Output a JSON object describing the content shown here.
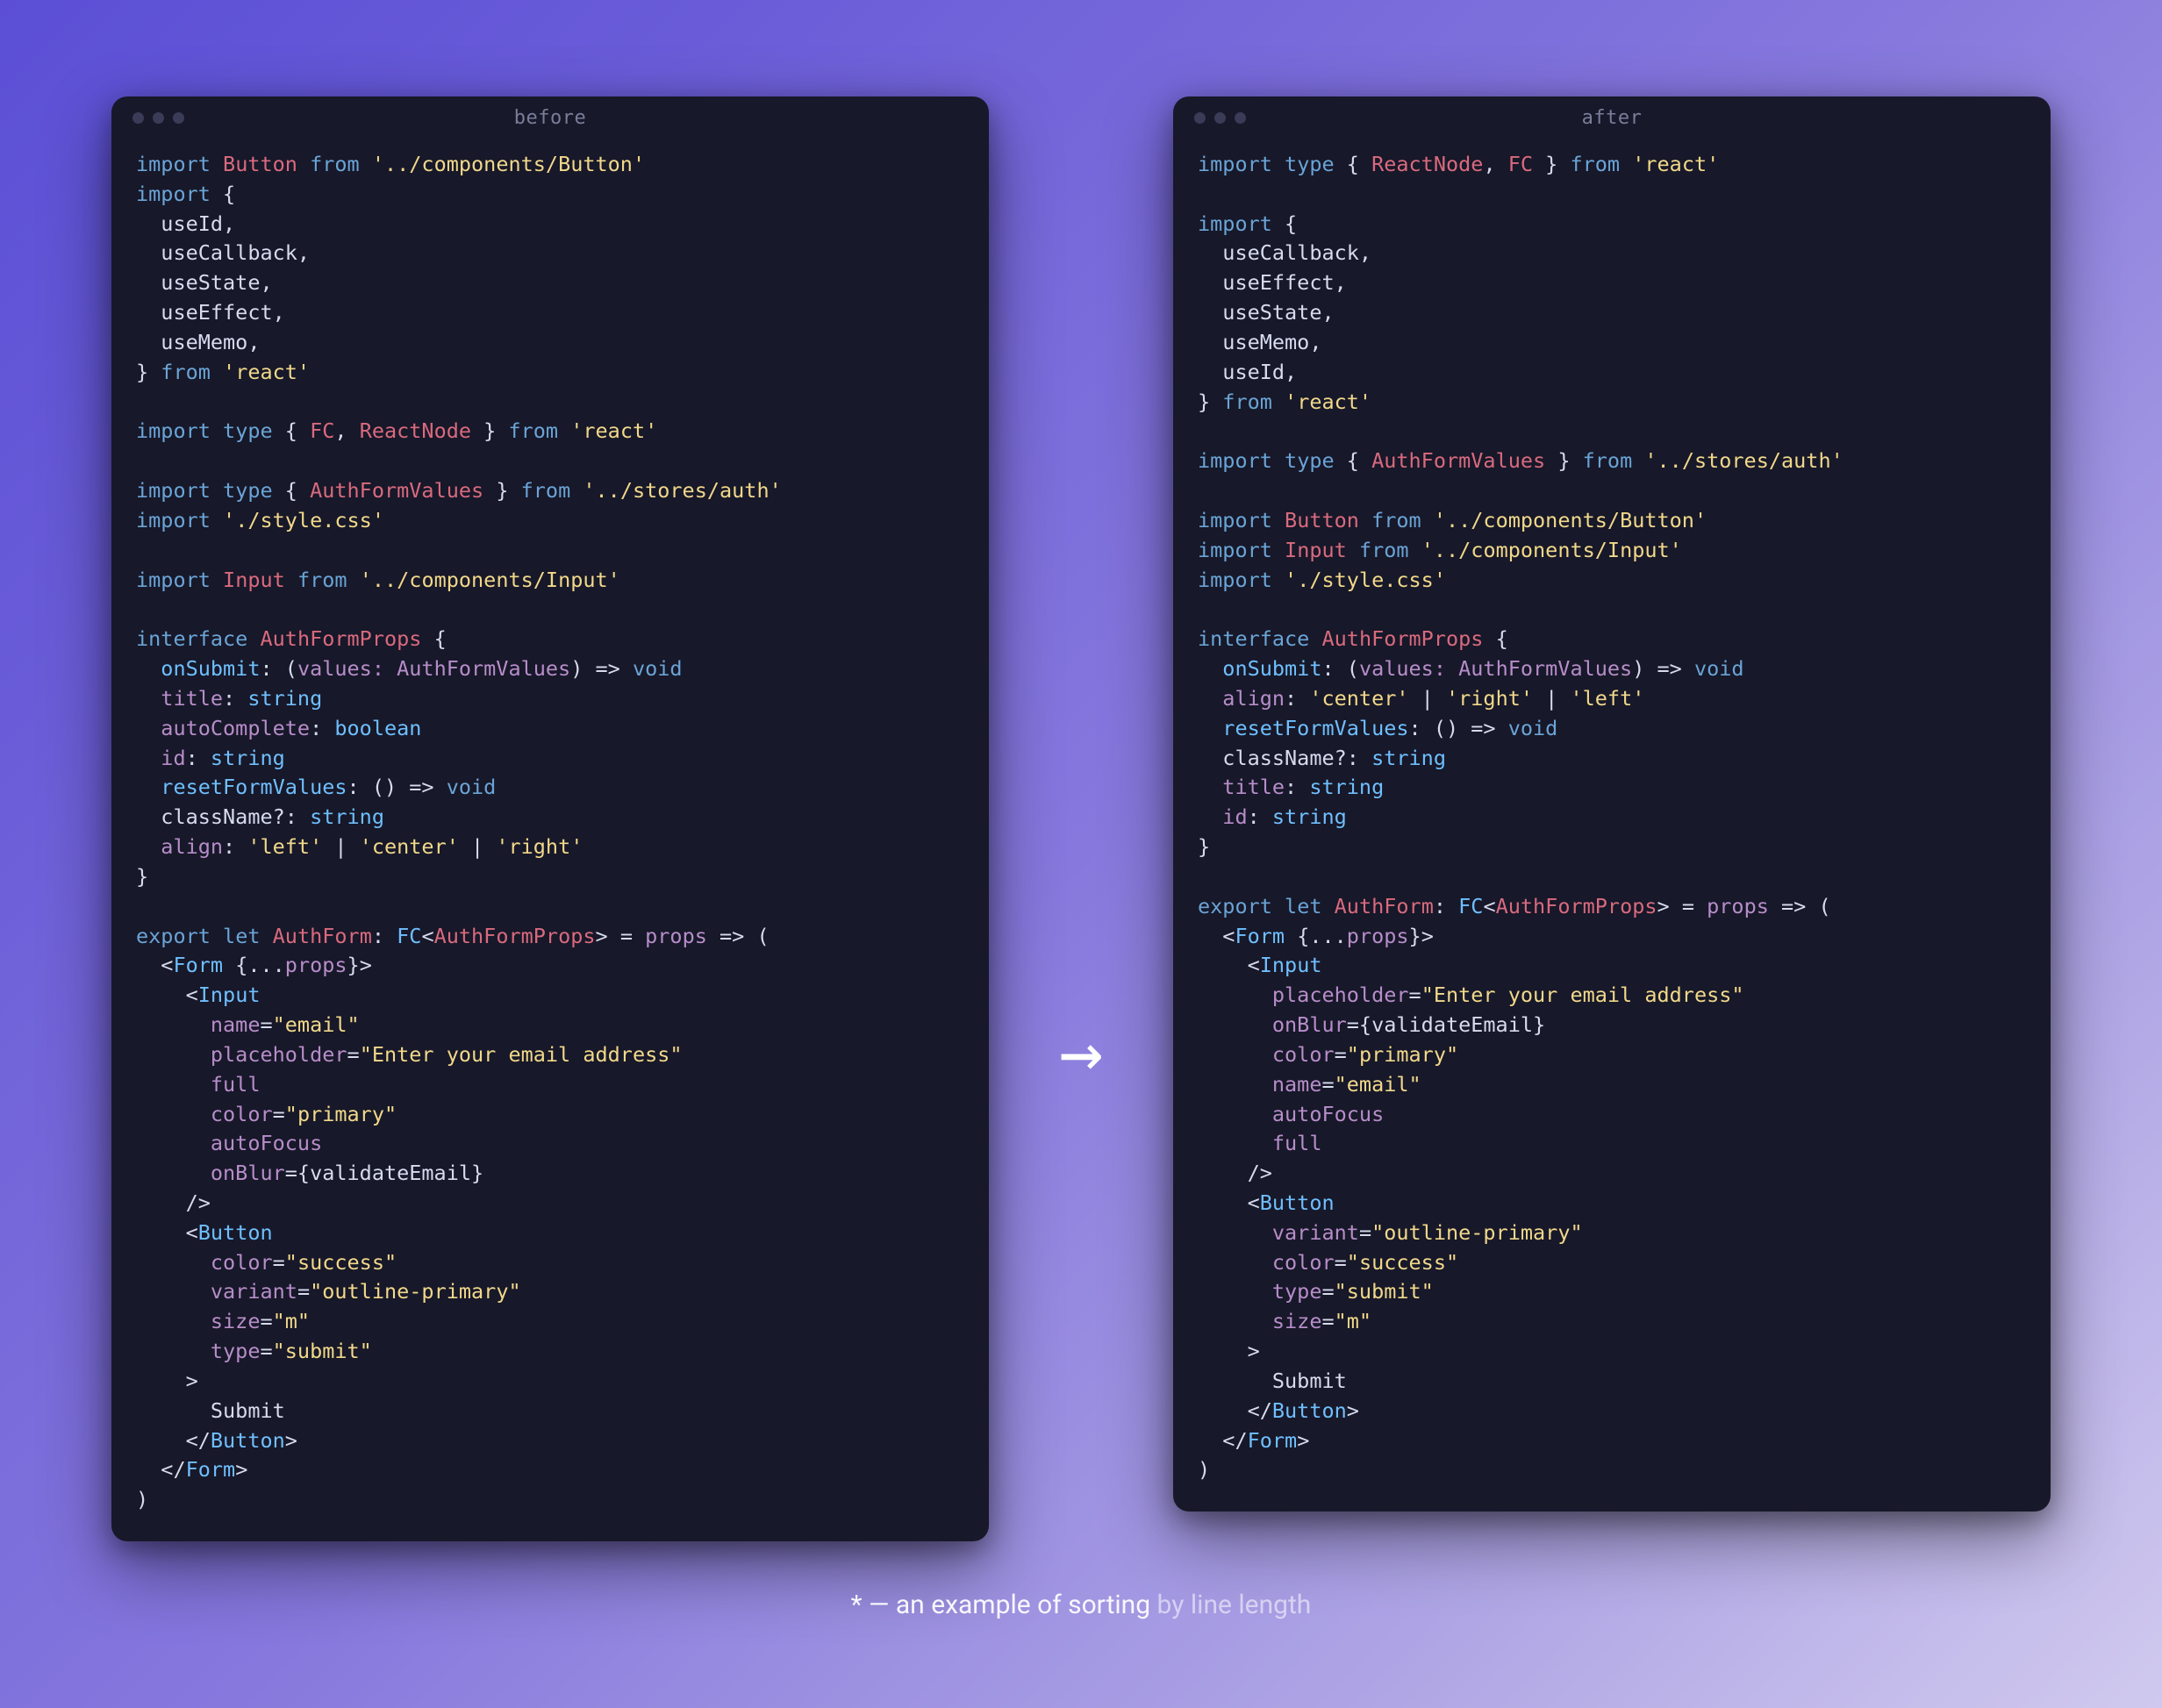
{
  "left": {
    "title": "before",
    "lines": [
      [
        [
          "kw",
          "import"
        ],
        [
          "plain",
          " "
        ],
        [
          "id-red",
          "Button"
        ],
        [
          "plain",
          " "
        ],
        [
          "kw",
          "from"
        ],
        [
          "plain",
          " "
        ],
        [
          "str",
          "'../components/Button'"
        ]
      ],
      [
        [
          "kw",
          "import"
        ],
        [
          "plain",
          " {"
        ]
      ],
      [
        [
          "plain",
          "  useId,"
        ]
      ],
      [
        [
          "plain",
          "  useCallback,"
        ]
      ],
      [
        [
          "plain",
          "  useState,"
        ]
      ],
      [
        [
          "plain",
          "  useEffect,"
        ]
      ],
      [
        [
          "plain",
          "  useMemo,"
        ]
      ],
      [
        [
          "plain",
          "} "
        ],
        [
          "kw",
          "from"
        ],
        [
          "plain",
          " "
        ],
        [
          "str",
          "'react'"
        ]
      ],
      [
        [
          "plain",
          ""
        ]
      ],
      [
        [
          "kw",
          "import"
        ],
        [
          "plain",
          " "
        ],
        [
          "kw",
          "type"
        ],
        [
          "plain",
          " { "
        ],
        [
          "id-red",
          "FC"
        ],
        [
          "plain",
          ", "
        ],
        [
          "id-red",
          "ReactNode"
        ],
        [
          "plain",
          " } "
        ],
        [
          "kw",
          "from"
        ],
        [
          "plain",
          " "
        ],
        [
          "str",
          "'react'"
        ]
      ],
      [
        [
          "plain",
          ""
        ]
      ],
      [
        [
          "kw",
          "import"
        ],
        [
          "plain",
          " "
        ],
        [
          "kw",
          "type"
        ],
        [
          "plain",
          " { "
        ],
        [
          "id-red",
          "AuthFormValues"
        ],
        [
          "plain",
          " } "
        ],
        [
          "kw",
          "from"
        ],
        [
          "plain",
          " "
        ],
        [
          "str",
          "'../stores/auth'"
        ]
      ],
      [
        [
          "kw",
          "import"
        ],
        [
          "plain",
          " "
        ],
        [
          "str",
          "'./style.css'"
        ]
      ],
      [
        [
          "plain",
          ""
        ]
      ],
      [
        [
          "kw",
          "import"
        ],
        [
          "plain",
          " "
        ],
        [
          "id-red",
          "Input"
        ],
        [
          "plain",
          " "
        ],
        [
          "kw",
          "from"
        ],
        [
          "plain",
          " "
        ],
        [
          "str",
          "'../components/Input'"
        ]
      ],
      [
        [
          "plain",
          ""
        ]
      ],
      [
        [
          "kw",
          "interface"
        ],
        [
          "plain",
          " "
        ],
        [
          "id-red",
          "AuthFormProps"
        ],
        [
          "plain",
          " {"
        ]
      ],
      [
        [
          "plain",
          "  "
        ],
        [
          "func",
          "onSubmit"
        ],
        [
          "plain",
          ": ("
        ],
        [
          "prop",
          "values: AuthFormValues"
        ],
        [
          "plain",
          ") => "
        ],
        [
          "kw",
          "void"
        ]
      ],
      [
        [
          "plain",
          "  "
        ],
        [
          "prop",
          "title"
        ],
        [
          "plain",
          ": "
        ],
        [
          "type",
          "string"
        ]
      ],
      [
        [
          "plain",
          "  "
        ],
        [
          "prop",
          "autoComplete"
        ],
        [
          "plain",
          ": "
        ],
        [
          "type",
          "boolean"
        ]
      ],
      [
        [
          "plain",
          "  "
        ],
        [
          "prop",
          "id"
        ],
        [
          "plain",
          ": "
        ],
        [
          "type",
          "string"
        ]
      ],
      [
        [
          "plain",
          "  "
        ],
        [
          "func",
          "resetFormValues"
        ],
        [
          "plain",
          ": () => "
        ],
        [
          "kw",
          "void"
        ]
      ],
      [
        [
          "plain",
          "  className?: "
        ],
        [
          "type",
          "string"
        ]
      ],
      [
        [
          "plain",
          "  "
        ],
        [
          "prop",
          "align"
        ],
        [
          "plain",
          ": "
        ],
        [
          "str",
          "'left'"
        ],
        [
          "plain",
          " | "
        ],
        [
          "str",
          "'center'"
        ],
        [
          "plain",
          " | "
        ],
        [
          "str",
          "'right'"
        ]
      ],
      [
        [
          "plain",
          "}"
        ]
      ],
      [
        [
          "plain",
          ""
        ]
      ],
      [
        [
          "kw",
          "export"
        ],
        [
          "plain",
          " "
        ],
        [
          "kw",
          "let"
        ],
        [
          "plain",
          " "
        ],
        [
          "id-red",
          "AuthForm"
        ],
        [
          "plain",
          ": "
        ],
        [
          "type",
          "FC"
        ],
        [
          "plain",
          "<"
        ],
        [
          "id-red",
          "AuthFormProps"
        ],
        [
          "plain",
          "> = "
        ],
        [
          "prop",
          "props"
        ],
        [
          "plain",
          " => ("
        ]
      ],
      [
        [
          "plain",
          "  <"
        ],
        [
          "jsx",
          "Form"
        ],
        [
          "plain",
          " {..."
        ],
        [
          "prop",
          "props"
        ],
        [
          "plain",
          "}>"
        ]
      ],
      [
        [
          "plain",
          "    <"
        ],
        [
          "jsx",
          "Input"
        ]
      ],
      [
        [
          "plain",
          "      "
        ],
        [
          "prop",
          "name"
        ],
        [
          "plain",
          "="
        ],
        [
          "str",
          "\"email\""
        ]
      ],
      [
        [
          "plain",
          "      "
        ],
        [
          "prop",
          "placeholder"
        ],
        [
          "plain",
          "="
        ],
        [
          "str",
          "\"Enter your email address\""
        ]
      ],
      [
        [
          "plain",
          "      "
        ],
        [
          "prop",
          "full"
        ]
      ],
      [
        [
          "plain",
          "      "
        ],
        [
          "prop",
          "color"
        ],
        [
          "plain",
          "="
        ],
        [
          "str",
          "\"primary\""
        ]
      ],
      [
        [
          "plain",
          "      "
        ],
        [
          "prop",
          "autoFocus"
        ]
      ],
      [
        [
          "plain",
          "      "
        ],
        [
          "prop",
          "onBlur"
        ],
        [
          "plain",
          "={"
        ],
        [
          "plain",
          "validateEmail"
        ],
        [
          "plain",
          "}"
        ]
      ],
      [
        [
          "plain",
          "    />"
        ]
      ],
      [
        [
          "plain",
          "    <"
        ],
        [
          "jsx",
          "Button"
        ]
      ],
      [
        [
          "plain",
          "      "
        ],
        [
          "prop",
          "color"
        ],
        [
          "plain",
          "="
        ],
        [
          "str",
          "\"success\""
        ]
      ],
      [
        [
          "plain",
          "      "
        ],
        [
          "prop",
          "variant"
        ],
        [
          "plain",
          "="
        ],
        [
          "str",
          "\"outline-primary\""
        ]
      ],
      [
        [
          "plain",
          "      "
        ],
        [
          "prop",
          "size"
        ],
        [
          "plain",
          "="
        ],
        [
          "str",
          "\"m\""
        ]
      ],
      [
        [
          "plain",
          "      "
        ],
        [
          "prop",
          "type"
        ],
        [
          "plain",
          "="
        ],
        [
          "str",
          "\"submit\""
        ]
      ],
      [
        [
          "plain",
          "    >"
        ]
      ],
      [
        [
          "plain",
          "      Submit"
        ]
      ],
      [
        [
          "plain",
          "    </"
        ],
        [
          "jsx",
          "Button"
        ],
        [
          "plain",
          ">"
        ]
      ],
      [
        [
          "plain",
          "  </"
        ],
        [
          "jsx",
          "Form"
        ],
        [
          "plain",
          ">"
        ]
      ],
      [
        [
          "plain",
          ")"
        ]
      ]
    ]
  },
  "right": {
    "title": "after",
    "lines": [
      [
        [
          "kw",
          "import"
        ],
        [
          "plain",
          " "
        ],
        [
          "kw",
          "type"
        ],
        [
          "plain",
          " { "
        ],
        [
          "id-red",
          "ReactNode"
        ],
        [
          "plain",
          ", "
        ],
        [
          "id-red",
          "FC"
        ],
        [
          "plain",
          " } "
        ],
        [
          "kw",
          "from"
        ],
        [
          "plain",
          " "
        ],
        [
          "str",
          "'react'"
        ]
      ],
      [
        [
          "plain",
          ""
        ]
      ],
      [
        [
          "kw",
          "import"
        ],
        [
          "plain",
          " {"
        ]
      ],
      [
        [
          "plain",
          "  useCallback,"
        ]
      ],
      [
        [
          "plain",
          "  useEffect,"
        ]
      ],
      [
        [
          "plain",
          "  useState,"
        ]
      ],
      [
        [
          "plain",
          "  useMemo,"
        ]
      ],
      [
        [
          "plain",
          "  useId,"
        ]
      ],
      [
        [
          "plain",
          "} "
        ],
        [
          "kw",
          "from"
        ],
        [
          "plain",
          " "
        ],
        [
          "str",
          "'react'"
        ]
      ],
      [
        [
          "plain",
          ""
        ]
      ],
      [
        [
          "kw",
          "import"
        ],
        [
          "plain",
          " "
        ],
        [
          "kw",
          "type"
        ],
        [
          "plain",
          " { "
        ],
        [
          "id-red",
          "AuthFormValues"
        ],
        [
          "plain",
          " } "
        ],
        [
          "kw",
          "from"
        ],
        [
          "plain",
          " "
        ],
        [
          "str",
          "'../stores/auth'"
        ]
      ],
      [
        [
          "plain",
          ""
        ]
      ],
      [
        [
          "kw",
          "import"
        ],
        [
          "plain",
          " "
        ],
        [
          "id-red",
          "Button"
        ],
        [
          "plain",
          " "
        ],
        [
          "kw",
          "from"
        ],
        [
          "plain",
          " "
        ],
        [
          "str",
          "'../components/Button'"
        ]
      ],
      [
        [
          "kw",
          "import"
        ],
        [
          "plain",
          " "
        ],
        [
          "id-red",
          "Input"
        ],
        [
          "plain",
          " "
        ],
        [
          "kw",
          "from"
        ],
        [
          "plain",
          " "
        ],
        [
          "str",
          "'../components/Input'"
        ]
      ],
      [
        [
          "kw",
          "import"
        ],
        [
          "plain",
          " "
        ],
        [
          "str",
          "'./style.css'"
        ]
      ],
      [
        [
          "plain",
          ""
        ]
      ],
      [
        [
          "kw",
          "interface"
        ],
        [
          "plain",
          " "
        ],
        [
          "id-red",
          "AuthFormProps"
        ],
        [
          "plain",
          " {"
        ]
      ],
      [
        [
          "plain",
          "  "
        ],
        [
          "func",
          "onSubmit"
        ],
        [
          "plain",
          ": ("
        ],
        [
          "prop",
          "values: AuthFormValues"
        ],
        [
          "plain",
          ") => "
        ],
        [
          "kw",
          "void"
        ]
      ],
      [
        [
          "plain",
          "  "
        ],
        [
          "prop",
          "align"
        ],
        [
          "plain",
          ": "
        ],
        [
          "str",
          "'center'"
        ],
        [
          "plain",
          " | "
        ],
        [
          "str",
          "'right'"
        ],
        [
          "plain",
          " | "
        ],
        [
          "str",
          "'left'"
        ]
      ],
      [
        [
          "plain",
          "  "
        ],
        [
          "func",
          "resetFormValues"
        ],
        [
          "plain",
          ": () => "
        ],
        [
          "kw",
          "void"
        ]
      ],
      [
        [
          "plain",
          "  className?: "
        ],
        [
          "type",
          "string"
        ]
      ],
      [
        [
          "plain",
          "  "
        ],
        [
          "prop",
          "title"
        ],
        [
          "plain",
          ": "
        ],
        [
          "type",
          "string"
        ]
      ],
      [
        [
          "plain",
          "  "
        ],
        [
          "prop",
          "id"
        ],
        [
          "plain",
          ": "
        ],
        [
          "type",
          "string"
        ]
      ],
      [
        [
          "plain",
          "}"
        ]
      ],
      [
        [
          "plain",
          ""
        ]
      ],
      [
        [
          "kw",
          "export"
        ],
        [
          "plain",
          " "
        ],
        [
          "kw",
          "let"
        ],
        [
          "plain",
          " "
        ],
        [
          "id-red",
          "AuthForm"
        ],
        [
          "plain",
          ": "
        ],
        [
          "type",
          "FC"
        ],
        [
          "plain",
          "<"
        ],
        [
          "id-red",
          "AuthFormProps"
        ],
        [
          "plain",
          "> = "
        ],
        [
          "prop",
          "props"
        ],
        [
          "plain",
          " => ("
        ]
      ],
      [
        [
          "plain",
          "  <"
        ],
        [
          "jsx",
          "Form"
        ],
        [
          "plain",
          " {..."
        ],
        [
          "prop",
          "props"
        ],
        [
          "plain",
          "}>"
        ]
      ],
      [
        [
          "plain",
          "    <"
        ],
        [
          "jsx",
          "Input"
        ]
      ],
      [
        [
          "plain",
          "      "
        ],
        [
          "prop",
          "placeholder"
        ],
        [
          "plain",
          "="
        ],
        [
          "str",
          "\"Enter your email address\""
        ]
      ],
      [
        [
          "plain",
          "      "
        ],
        [
          "prop",
          "onBlur"
        ],
        [
          "plain",
          "={"
        ],
        [
          "plain",
          "validateEmail"
        ],
        [
          "plain",
          "}"
        ]
      ],
      [
        [
          "plain",
          "      "
        ],
        [
          "prop",
          "color"
        ],
        [
          "plain",
          "="
        ],
        [
          "str",
          "\"primary\""
        ]
      ],
      [
        [
          "plain",
          "      "
        ],
        [
          "prop",
          "name"
        ],
        [
          "plain",
          "="
        ],
        [
          "str",
          "\"email\""
        ]
      ],
      [
        [
          "plain",
          "      "
        ],
        [
          "prop",
          "autoFocus"
        ]
      ],
      [
        [
          "plain",
          "      "
        ],
        [
          "prop",
          "full"
        ]
      ],
      [
        [
          "plain",
          "    />"
        ]
      ],
      [
        [
          "plain",
          "    <"
        ],
        [
          "jsx",
          "Button"
        ]
      ],
      [
        [
          "plain",
          "      "
        ],
        [
          "prop",
          "variant"
        ],
        [
          "plain",
          "="
        ],
        [
          "str",
          "\"outline-primary\""
        ]
      ],
      [
        [
          "plain",
          "      "
        ],
        [
          "prop",
          "color"
        ],
        [
          "plain",
          "="
        ],
        [
          "str",
          "\"success\""
        ]
      ],
      [
        [
          "plain",
          "      "
        ],
        [
          "prop",
          "type"
        ],
        [
          "plain",
          "="
        ],
        [
          "str",
          "\"submit\""
        ]
      ],
      [
        [
          "plain",
          "      "
        ],
        [
          "prop",
          "size"
        ],
        [
          "plain",
          "="
        ],
        [
          "str",
          "\"m\""
        ]
      ],
      [
        [
          "plain",
          "    >"
        ]
      ],
      [
        [
          "plain",
          "      Submit"
        ]
      ],
      [
        [
          "plain",
          "    </"
        ],
        [
          "jsx",
          "Button"
        ],
        [
          "plain",
          ">"
        ]
      ],
      [
        [
          "plain",
          "  </"
        ],
        [
          "jsx",
          "Form"
        ],
        [
          "plain",
          ">"
        ]
      ],
      [
        [
          "plain",
          ")"
        ]
      ]
    ]
  },
  "caption": {
    "prefix": "* — an example of sorting",
    "dim": " by line length"
  },
  "arrow": "→"
}
